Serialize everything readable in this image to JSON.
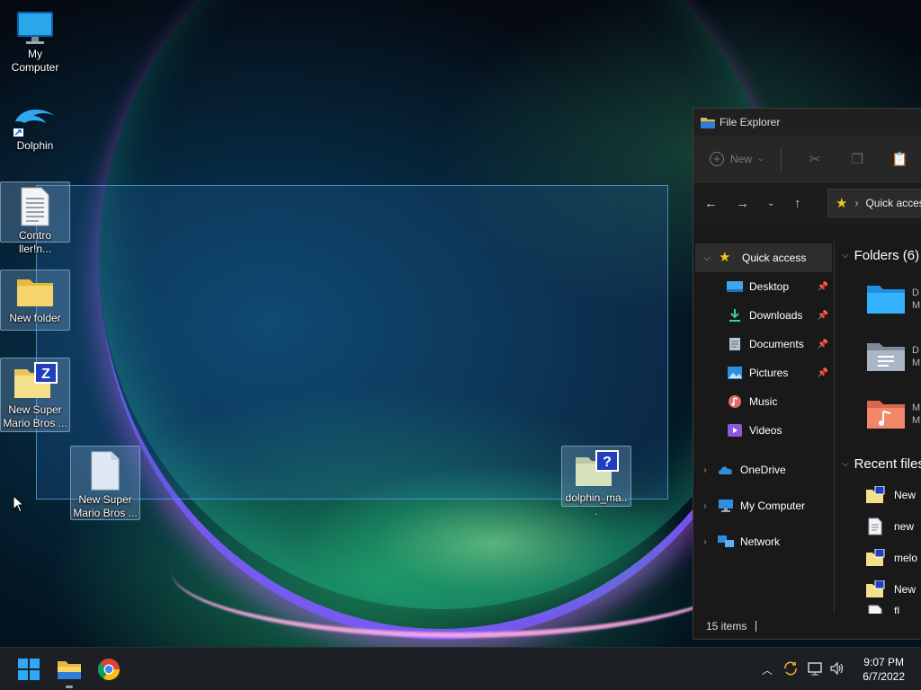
{
  "desktop": {
    "icons": [
      {
        "label": "My Computer",
        "icon": "monitor-icon"
      },
      {
        "label": "Dolphin",
        "icon": "dolphin-icon"
      },
      {
        "label": "Contro ller!n...",
        "icon": "text-file-icon"
      },
      {
        "label": "New folder",
        "icon": "folder-icon"
      },
      {
        "label": "New Super Mario Bros ...",
        "icon": "zip-folder-icon"
      },
      {
        "label": "New Super Mario Bros ...",
        "icon": "blank-file-icon"
      },
      {
        "label": "dolphin_ma...",
        "icon": "zip-folder-icon"
      }
    ]
  },
  "explorer": {
    "title": "File Explorer",
    "toolbar": {
      "new_label": "New"
    },
    "address": {
      "location": "Quick access"
    },
    "sidebar": {
      "quick_access": "Quick access",
      "pinned": [
        {
          "label": "Desktop",
          "icon": "desktop-icon"
        },
        {
          "label": "Downloads",
          "icon": "download-icon"
        },
        {
          "label": "Documents",
          "icon": "document-icon"
        },
        {
          "label": "Pictures",
          "icon": "picture-icon"
        },
        {
          "label": "Music",
          "icon": "music-icon"
        },
        {
          "label": "Videos",
          "icon": "video-icon"
        }
      ],
      "onedrive": "OneDrive",
      "my_computer": "My Computer",
      "network": "Network"
    },
    "main": {
      "folders_heading": "Folders (6)",
      "folder_tiles": [
        {
          "label_a": "D",
          "label_b": "M"
        },
        {
          "label_a": "D",
          "label_b": "M"
        },
        {
          "label_a": "M",
          "label_b": "M"
        }
      ],
      "recent_heading": "Recent files",
      "recent": [
        {
          "label": "New",
          "icon": "zip-folder-icon"
        },
        {
          "label": "new",
          "icon": "text-file-icon"
        },
        {
          "label": "melo",
          "icon": "zip-folder-icon"
        },
        {
          "label": "New",
          "icon": "zip-folder-icon"
        },
        {
          "label": "fl",
          "icon": "blank-file-icon"
        }
      ]
    },
    "status": {
      "items": "15 items"
    }
  },
  "taskbar": {
    "time": "9:07 PM",
    "date": "6/7/2022"
  },
  "colors": {
    "accent": "#0078d4",
    "folder_yellow": "#f2c94c",
    "explorer_bg": "#191919",
    "taskbar_bg": "#1c1f24"
  }
}
